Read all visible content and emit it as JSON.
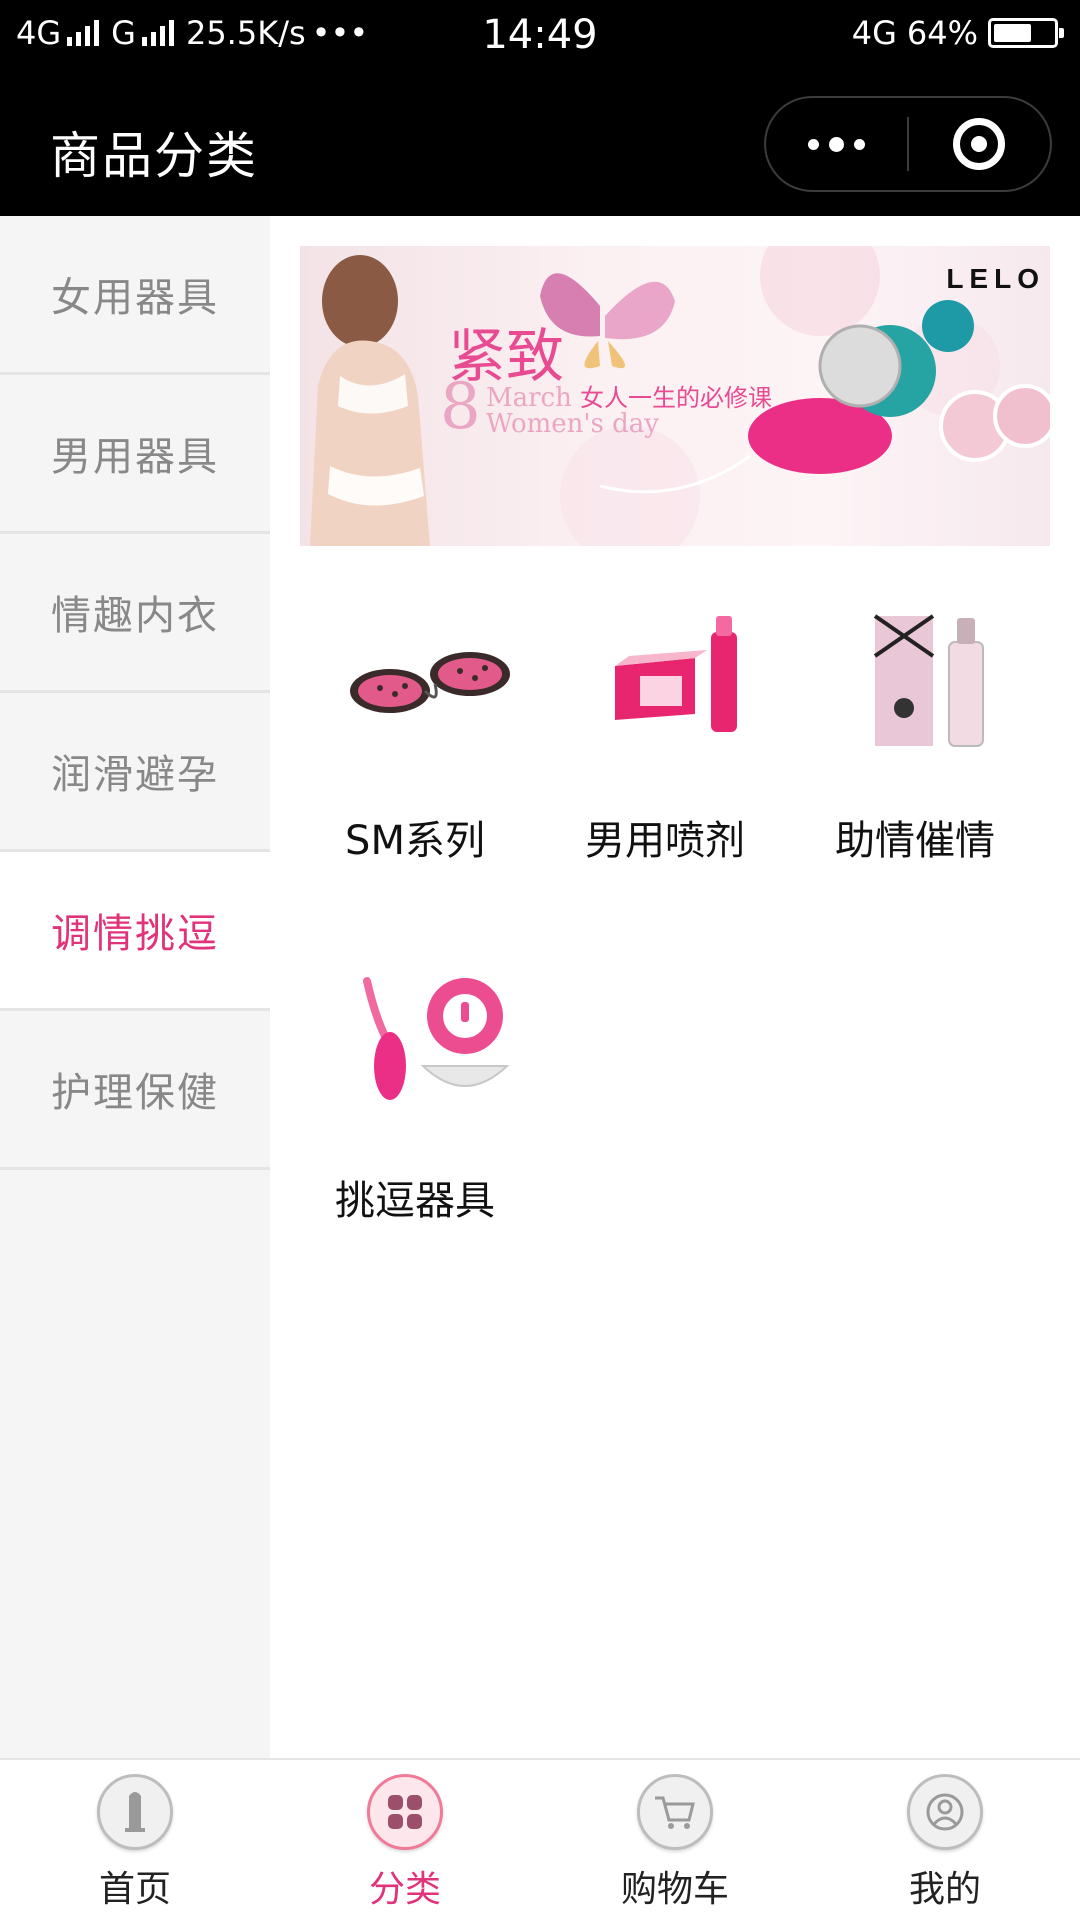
{
  "status_bar": {
    "network_left": "4G",
    "carrier_g": "G",
    "speed": "25.5K/s",
    "more": "•••",
    "time": "14:49",
    "network_right": "4G",
    "battery": "64%",
    "battery_level": 0.64
  },
  "nav": {
    "title": "商品分类"
  },
  "sidebar": {
    "items": [
      {
        "label": "女用器具"
      },
      {
        "label": "男用器具"
      },
      {
        "label": "情趣内衣"
      },
      {
        "label": "润滑避孕"
      },
      {
        "label": "调情挑逗",
        "active": true
      },
      {
        "label": "护理保健"
      }
    ]
  },
  "banner": {
    "brand": "LELO",
    "headline": "紧致",
    "number": "8",
    "line1_en": "March",
    "line1_cn": "女人一生的必修课",
    "line2_en": "Women's day"
  },
  "categories": [
    {
      "label": "SM系列",
      "icon": "handcuffs-icon"
    },
    {
      "label": "男用喷剂",
      "icon": "spray-icon"
    },
    {
      "label": "助情催情",
      "icon": "perfume-icon"
    },
    {
      "label": "挑逗器具",
      "icon": "vibrator-icon"
    }
  ],
  "tabbar": {
    "tabs": [
      {
        "label": "首页",
        "icon": "home-icon"
      },
      {
        "label": "分类",
        "icon": "category-icon",
        "active": true
      },
      {
        "label": "购物车",
        "icon": "cart-icon"
      },
      {
        "label": "我的",
        "icon": "user-icon"
      }
    ]
  },
  "colors": {
    "accent": "#e0337a",
    "sidebar_bg": "#f5f5f5",
    "bar_bg": "#000000"
  }
}
